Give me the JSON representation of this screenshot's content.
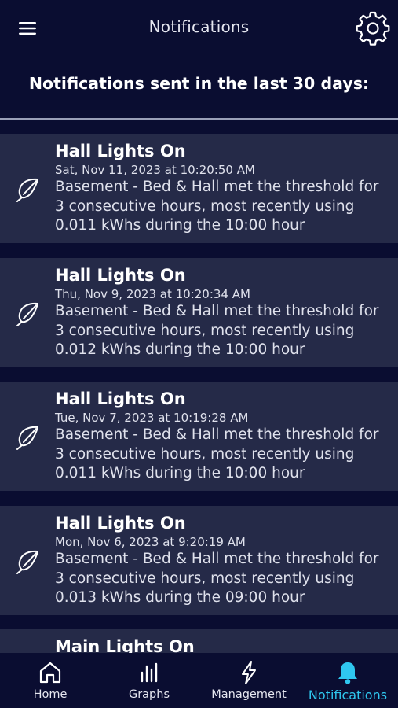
{
  "header": {
    "title": "Notifications",
    "menu_icon": "hamburger-menu-icon",
    "settings_icon": "gear-icon"
  },
  "subheader": "Notifications sent in the last 30 days:",
  "notifications": [
    {
      "title": "Hall Lights On",
      "timestamp": "Sat, Nov 11, 2023 at 10:20:50 AM",
      "body_lines": [
        "Basement - Bed & Hall met the threshold for",
        "3 consecutive hours, most recently using",
        "0.011 kWhs during the 10:00 hour"
      ],
      "icon": "leaf-icon"
    },
    {
      "title": "Hall Lights On",
      "timestamp": "Thu, Nov 9, 2023 at 10:20:34 AM",
      "body_lines": [
        "Basement - Bed & Hall met the threshold for",
        "3 consecutive hours, most recently using",
        "0.012 kWhs during the 10:00 hour"
      ],
      "icon": "leaf-icon"
    },
    {
      "title": "Hall Lights On",
      "timestamp": "Tue, Nov 7, 2023 at 10:19:28 AM",
      "body_lines": [
        "Basement - Bed & Hall met the threshold for",
        "3 consecutive hours, most recently using",
        "0.011 kWhs during the 10:00 hour"
      ],
      "icon": "leaf-icon"
    },
    {
      "title": "Hall Lights On",
      "timestamp": "Mon, Nov 6, 2023 at 9:20:19 AM",
      "body_lines": [
        "Basement - Bed & Hall met the threshold for",
        "3 consecutive hours, most recently using",
        "0.013 kWhs during the 09:00 hour"
      ],
      "icon": "leaf-icon"
    },
    {
      "title": "Main Lights On"
    }
  ],
  "tabs": [
    {
      "label": "Home",
      "icon": "home-icon"
    },
    {
      "label": "Graphs",
      "icon": "bar-graph-icon"
    },
    {
      "label": "Management",
      "icon": "lightning-bolt-icon"
    },
    {
      "label": "Notifications",
      "icon": "bell-icon",
      "active": true
    }
  ],
  "colors": {
    "background": "#0a0d31",
    "card": "#252a48",
    "active_tab": "#2fc7ef"
  }
}
